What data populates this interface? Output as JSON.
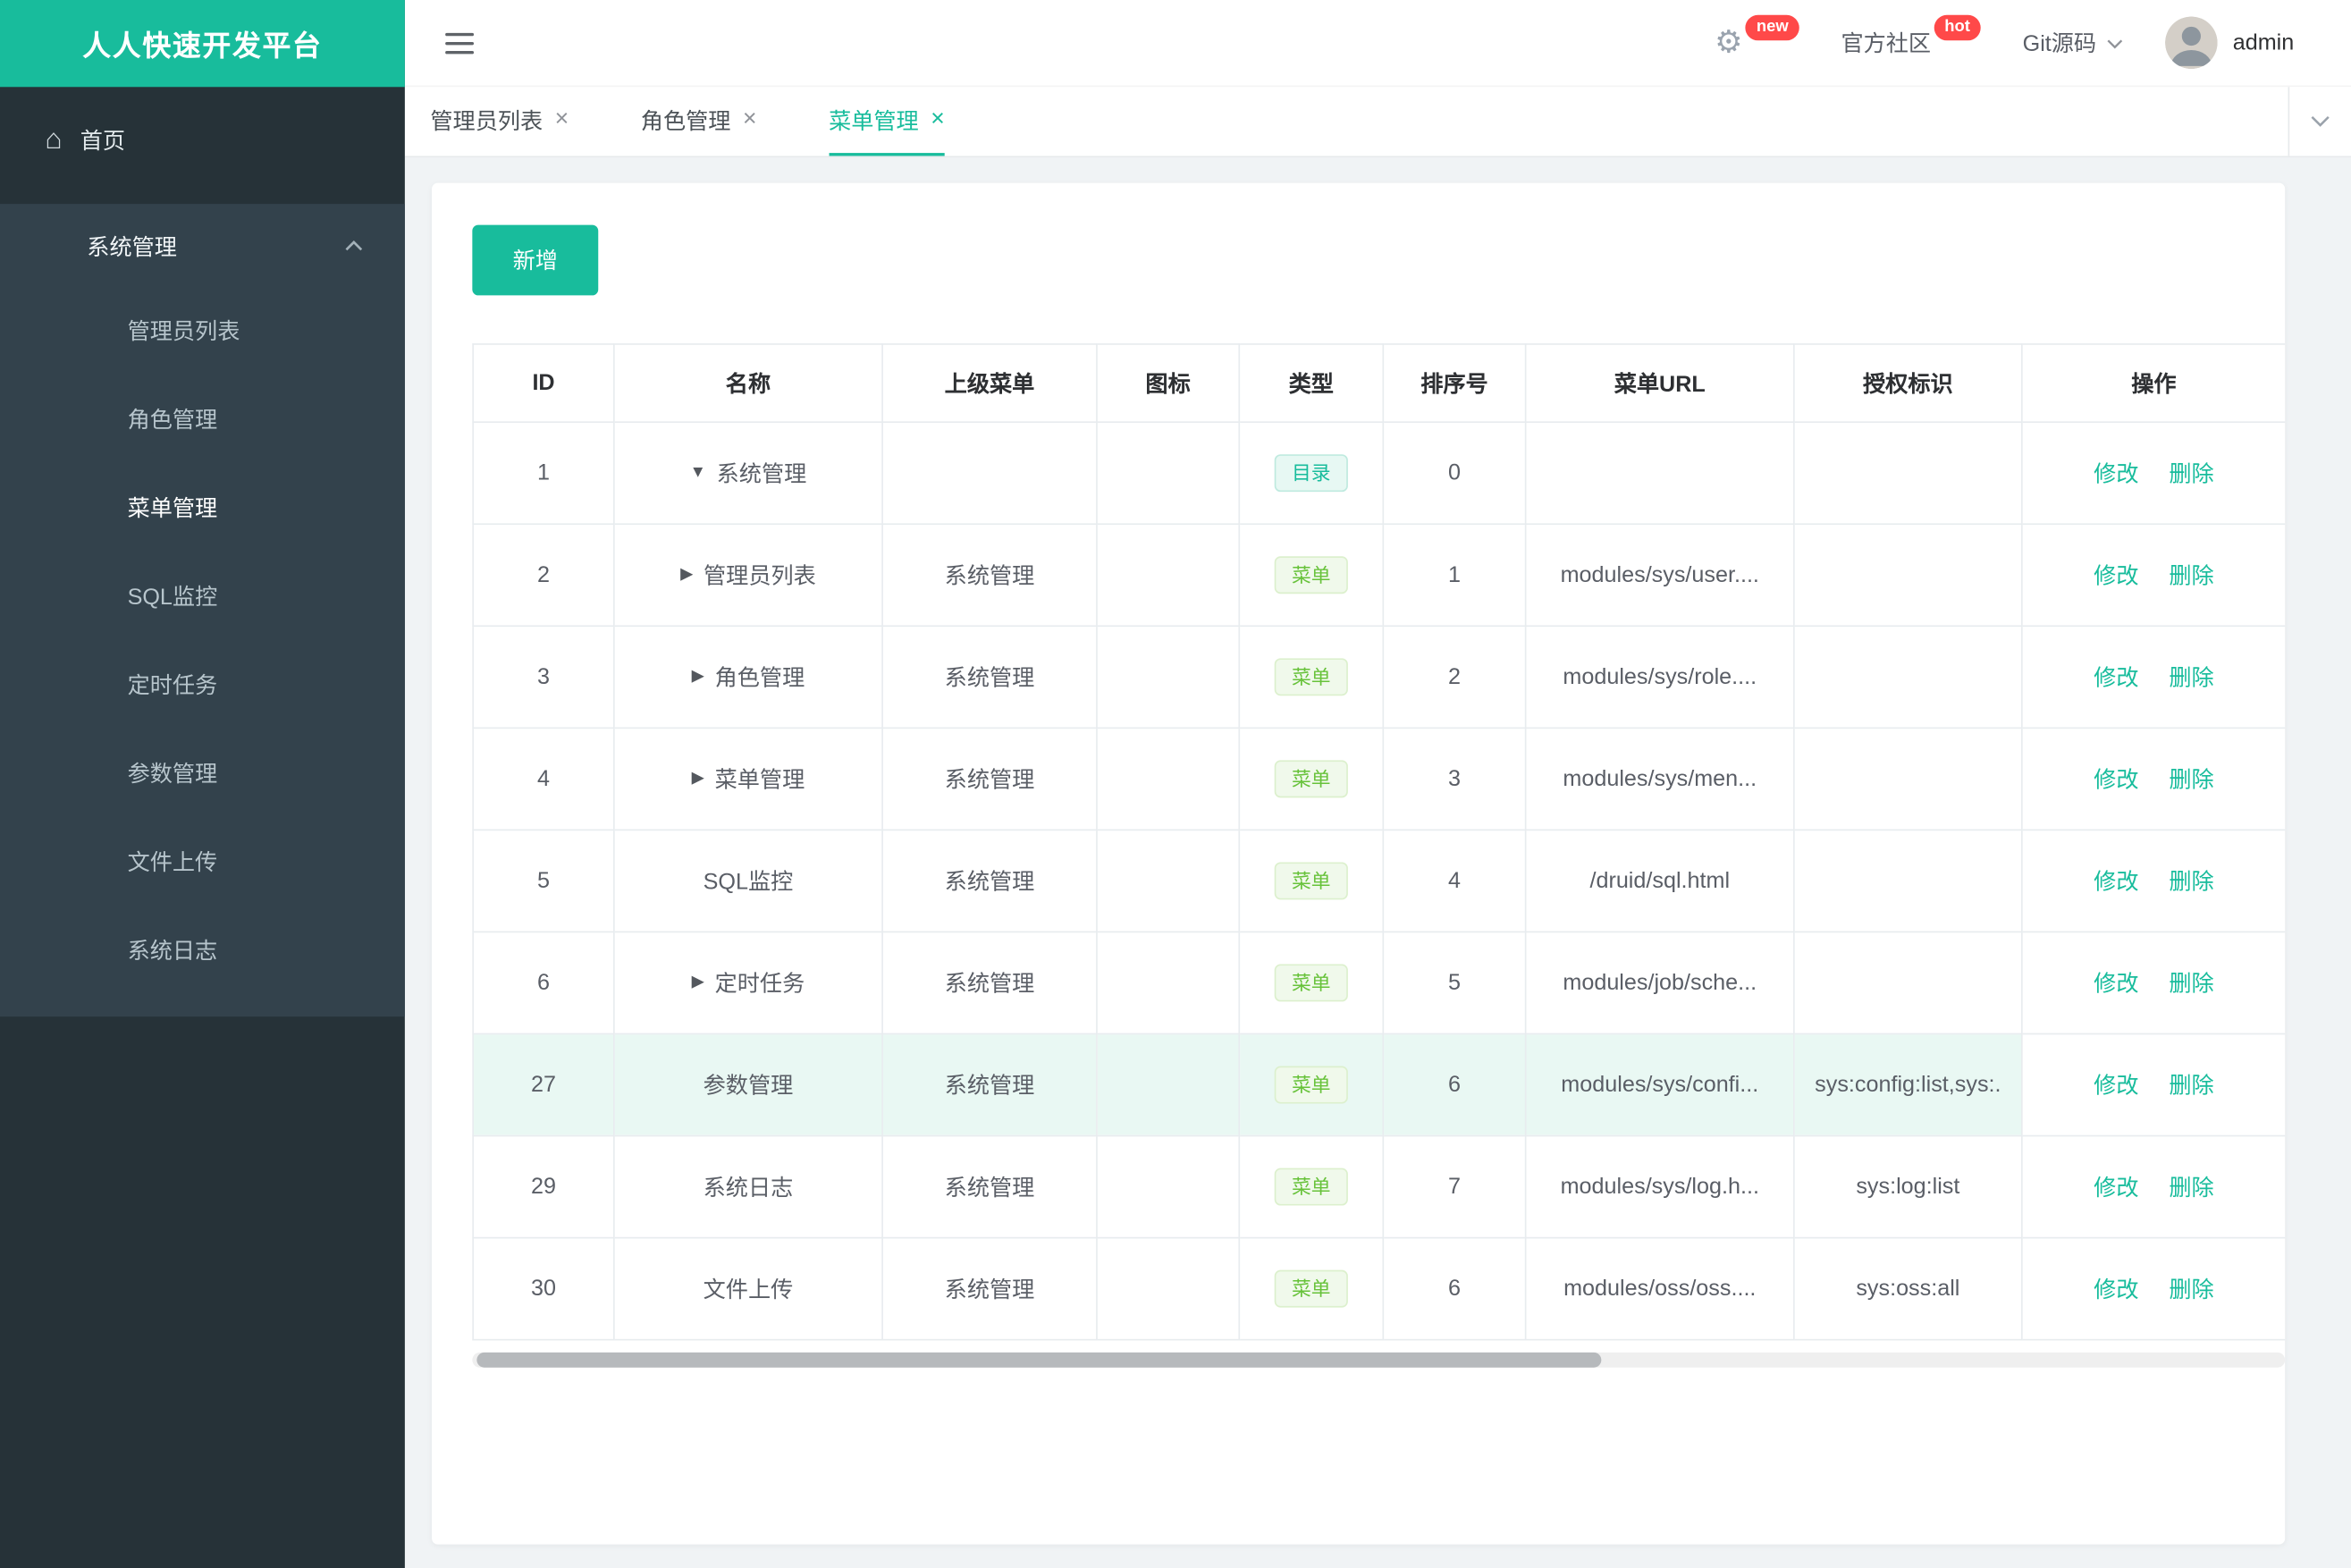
{
  "app": {
    "title": "人人快速开发平台"
  },
  "icons": {
    "home": "⌂",
    "gear": "⚙",
    "close": "×",
    "arrow_down": "▼",
    "arrow_right": "▶"
  },
  "topbar": {
    "gear_badge": "new",
    "community": "官方社区",
    "community_badge": "hot",
    "git": "Git源码",
    "username": "admin"
  },
  "sidebar": {
    "home": "首页",
    "group": "系统管理",
    "items": [
      {
        "label": "管理员列表",
        "active": false
      },
      {
        "label": "角色管理",
        "active": false
      },
      {
        "label": "菜单管理",
        "active": true
      },
      {
        "label": "SQL监控",
        "active": false
      },
      {
        "label": "定时任务",
        "active": false
      },
      {
        "label": "参数管理",
        "active": false
      },
      {
        "label": "文件上传",
        "active": false
      },
      {
        "label": "系统日志",
        "active": false
      }
    ]
  },
  "tabs": [
    {
      "label": "管理员列表",
      "active": false
    },
    {
      "label": "角色管理",
      "active": false
    },
    {
      "label": "菜单管理",
      "active": true
    }
  ],
  "toolbar": {
    "add_label": "新增"
  },
  "table": {
    "headers": [
      "ID",
      "名称",
      "上级菜单",
      "图标",
      "类型",
      "排序号",
      "菜单URL",
      "授权标识",
      "操作"
    ],
    "actions": {
      "edit": "修改",
      "delete": "删除"
    },
    "rows": [
      {
        "id": "1",
        "arrow": "down",
        "name": "系统管理",
        "parent": "",
        "icon": "",
        "type": "目录",
        "type_kind": "dir",
        "order": "0",
        "url": "",
        "perm": "",
        "highlight": false
      },
      {
        "id": "2",
        "arrow": "right",
        "name": "管理员列表",
        "parent": "系统管理",
        "icon": "",
        "type": "菜单",
        "type_kind": "menu",
        "order": "1",
        "url": "modules/sys/user....",
        "perm": "",
        "highlight": false
      },
      {
        "id": "3",
        "arrow": "right",
        "name": "角色管理",
        "parent": "系统管理",
        "icon": "",
        "type": "菜单",
        "type_kind": "menu",
        "order": "2",
        "url": "modules/sys/role....",
        "perm": "",
        "highlight": false
      },
      {
        "id": "4",
        "arrow": "right",
        "name": "菜单管理",
        "parent": "系统管理",
        "icon": "",
        "type": "菜单",
        "type_kind": "menu",
        "order": "3",
        "url": "modules/sys/men...",
        "perm": "",
        "highlight": false
      },
      {
        "id": "5",
        "arrow": "",
        "name": "SQL监控",
        "parent": "系统管理",
        "icon": "",
        "type": "菜单",
        "type_kind": "menu",
        "order": "4",
        "url": "/druid/sql.html",
        "perm": "",
        "highlight": false
      },
      {
        "id": "6",
        "arrow": "right",
        "name": "定时任务",
        "parent": "系统管理",
        "icon": "",
        "type": "菜单",
        "type_kind": "menu",
        "order": "5",
        "url": "modules/job/sche...",
        "perm": "",
        "highlight": false
      },
      {
        "id": "27",
        "arrow": "",
        "name": "参数管理",
        "parent": "系统管理",
        "icon": "",
        "type": "菜单",
        "type_kind": "menu",
        "order": "6",
        "url": "modules/sys/confi...",
        "perm": "sys:config:list,sys:.",
        "highlight": true
      },
      {
        "id": "29",
        "arrow": "",
        "name": "系统日志",
        "parent": "系统管理",
        "icon": "",
        "type": "菜单",
        "type_kind": "menu",
        "order": "7",
        "url": "modules/sys/log.h...",
        "perm": "sys:log:list",
        "highlight": false
      },
      {
        "id": "30",
        "arrow": "",
        "name": "文件上传",
        "parent": "系统管理",
        "icon": "",
        "type": "菜单",
        "type_kind": "menu",
        "order": "6",
        "url": "modules/oss/oss....",
        "perm": "sys:oss:all",
        "highlight": false
      }
    ]
  },
  "colors": {
    "primary": "#18bc9c",
    "sidebar_bg": "#263238",
    "sidebar_group_bg": "#33424c",
    "badge_red": "#ff4949",
    "tag_menu_green": "#67c23a",
    "row_highlight": "#e9f8f3"
  }
}
